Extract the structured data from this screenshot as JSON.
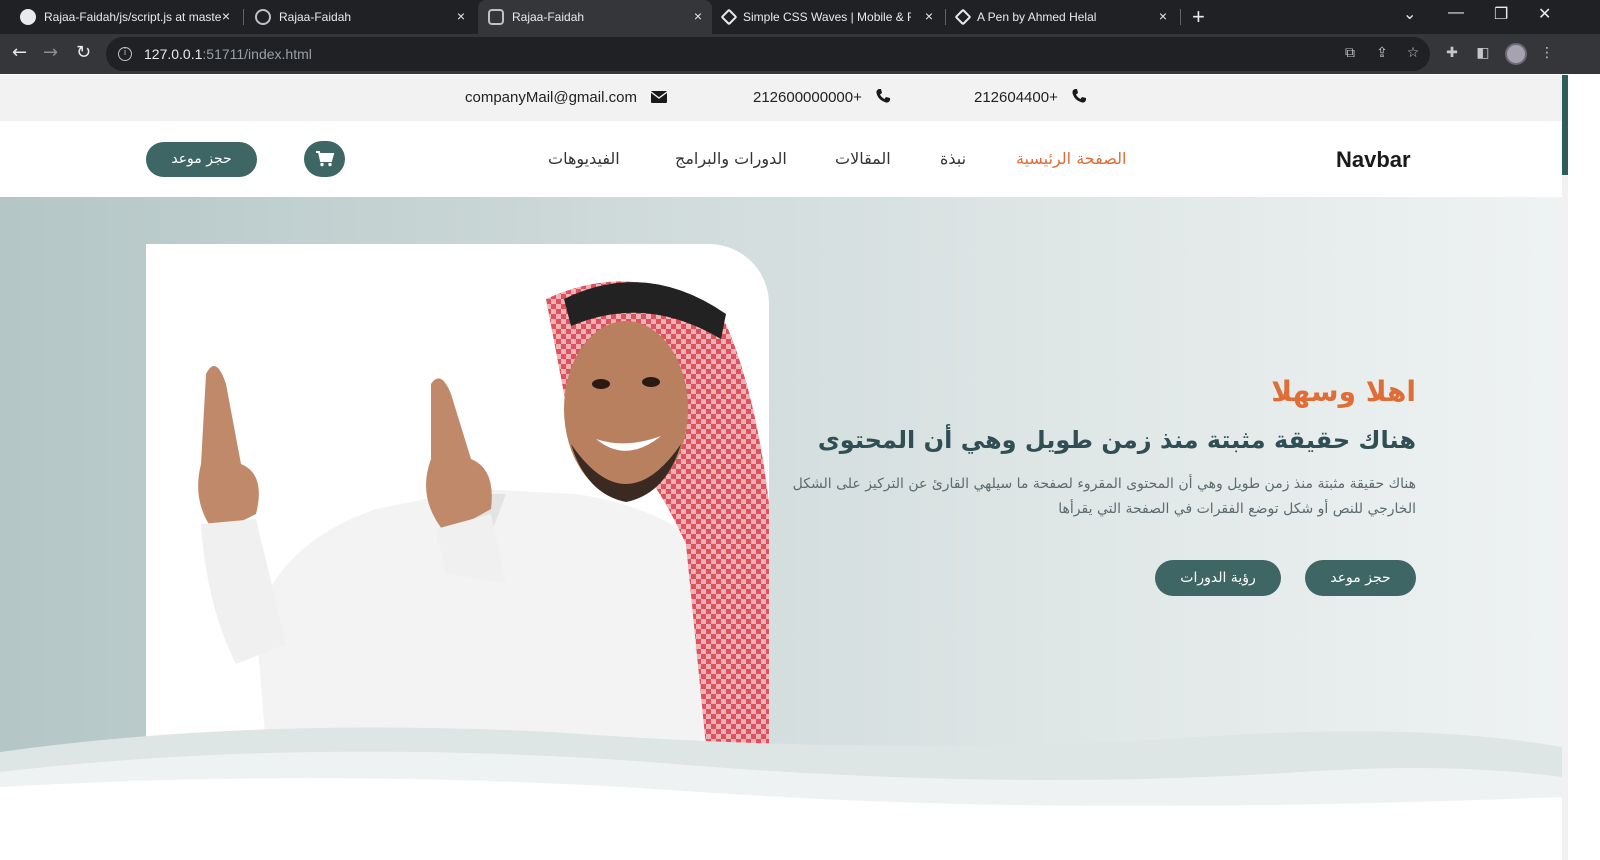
{
  "browser": {
    "tabs": [
      {
        "title": "Rajaa-Faidah/js/script.js at maste",
        "icon": "github-icon"
      },
      {
        "title": "Rajaa-Faidah",
        "icon": "globe-icon"
      },
      {
        "title": "Rajaa-Faidah",
        "icon": "broadcast-icon"
      },
      {
        "title": "Simple CSS Waves | Mobile & Fu",
        "icon": "codepen-icon"
      },
      {
        "title": "A Pen by Ahmed Helal",
        "icon": "codepen-icon"
      }
    ],
    "active_tab": 2,
    "close_glyph": "×",
    "new_tab_glyph": "+",
    "url_host": "127.0.0.1",
    "url_path": ":51711/index.html"
  },
  "topbar": {
    "email": "companyMail@gmail.com",
    "phone1": "212600000000+",
    "phone2": "212604400+"
  },
  "navbar": {
    "brand": "Navbar",
    "items": [
      {
        "label": "الصفحة الرئيسية",
        "active": true
      },
      {
        "label": "نبذة",
        "active": false
      },
      {
        "label": "المقالات",
        "active": false
      },
      {
        "label": "الدورات والبرامج",
        "active": false
      },
      {
        "label": "الفيديوهات",
        "active": false
      }
    ],
    "book_label": "حجز موعد"
  },
  "hero": {
    "welcome": "اهلا وسهلا",
    "headline": "هناك حقيقة مثبتة منذ زمن طويل وهي أن المحتوى",
    "paragraph": "هناك حقيقة مثبتة منذ زمن طويل وهي أن المحتوى المقروء لصفحة ما سيلهي القارئ عن التركيز على الشكل الخارجي للنص أو شكل توضع الفقرات في الصفحة التي يقرأها",
    "primary_button": "حجز موعد",
    "secondary_button": "رؤية الدورات"
  },
  "colors": {
    "accent": "#e06c36",
    "primary": "#3d6664",
    "heading": "#2f4f55"
  }
}
